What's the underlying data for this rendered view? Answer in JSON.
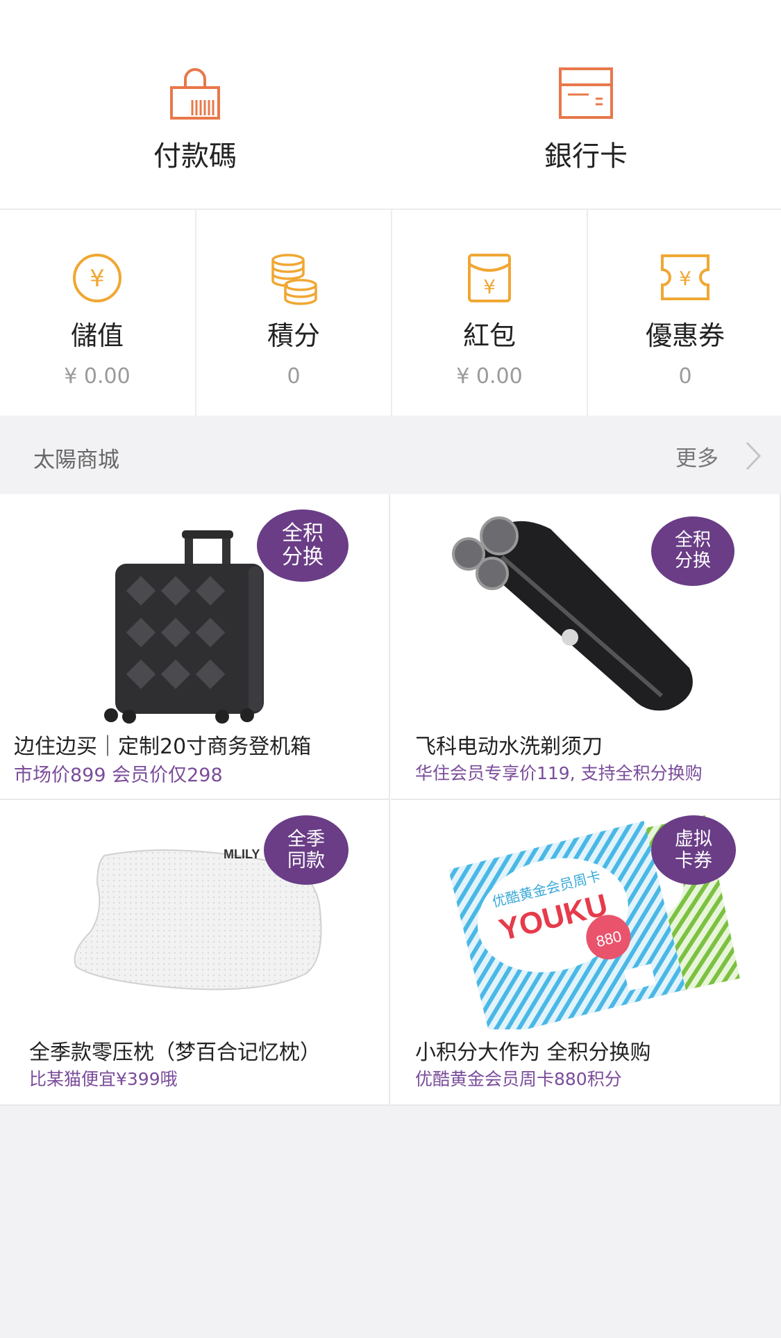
{
  "top_actions": [
    {
      "label": "付款碼",
      "icon": "payment-code-icon"
    },
    {
      "label": "銀行卡",
      "icon": "bank-card-icon"
    }
  ],
  "assets": [
    {
      "label": "儲值",
      "value": "¥ 0.00",
      "icon": "yuan-circle-icon"
    },
    {
      "label": "積分",
      "value": "0",
      "icon": "coins-stack-icon"
    },
    {
      "label": "紅包",
      "value": "¥ 0.00",
      "icon": "red-envelope-icon"
    },
    {
      "label": "優惠券",
      "value": "0",
      "icon": "coupon-ticket-icon"
    }
  ],
  "mall": {
    "title": "太陽商城",
    "more_label": "更多",
    "products": [
      {
        "title": "边住边买｜定制20寸商务登机箱",
        "subtitle": "市场价899 会员价仅298",
        "badge_line1": "全积",
        "badge_line2": "分换",
        "image": "suitcase"
      },
      {
        "title": "飞科电动水洗剃须刀",
        "subtitle": "华住会员专享价119, 支持全积分换购",
        "badge_line1": "全积",
        "badge_line2": "分换",
        "image": "shaver"
      },
      {
        "title": "全季款零压枕（梦百合记忆枕）",
        "subtitle": "比某猫便宜¥399哦",
        "badge_line1": "全季",
        "badge_line2": "同款",
        "image": "pillow",
        "image_text": "MLILY"
      },
      {
        "title": "小积分大作为 全积分换购",
        "subtitle": "优酷黄金会员周卡880积分",
        "badge_line1": "虚拟",
        "badge_line2": "卡券",
        "image": "vip-cards",
        "image_text": "YOUKU",
        "card_caption": "优酷黄金会员周卡",
        "card_points": "880"
      }
    ]
  },
  "colors": {
    "accent_orange": "#e8784a",
    "accent_gold": "#f0a733",
    "badge_purple": "#6a3d86",
    "subtitle_purple": "#7a4c9a"
  }
}
